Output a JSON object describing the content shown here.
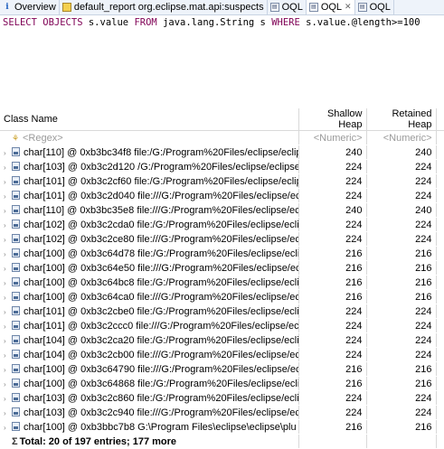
{
  "tabs": [
    {
      "label": "Overview",
      "icon": "info-icon",
      "active": false
    },
    {
      "label": "default_report  org.eclipse.mat.api:suspects",
      "icon": "report-icon",
      "active": false
    },
    {
      "label": "OQL",
      "icon": "oql-icon",
      "active": false
    },
    {
      "label": "OQL",
      "icon": "oql-icon",
      "active": true,
      "close": "✕"
    },
    {
      "label": "OQL",
      "icon": "oql-icon",
      "active": false
    }
  ],
  "query": {
    "kw_select": "SELECT",
    "kw_objects": "OBJECTS",
    "field": "s.value",
    "kw_from": "FROM",
    "klass": "java.lang.String s",
    "kw_where": "WHERE",
    "condition": "s.value.@length>=100"
  },
  "table": {
    "columns": [
      "Class Name",
      "Shallow Heap",
      "Retained Heap"
    ],
    "filter": {
      "regex": "<Regex>",
      "numeric1": "<Numeric>",
      "numeric2": "<Numeric>"
    },
    "rows": [
      {
        "name": "char[110] @ 0xb3bc34f8  file:/G:/Program%20Files/eclipse/eclip",
        "shallow": "240",
        "retained": "240"
      },
      {
        "name": "char[103] @ 0xb3c2d120  /G:/Program%20Files/eclipse/eclipse",
        "shallow": "224",
        "retained": "224"
      },
      {
        "name": "char[101] @ 0xb3c2cf60  file:/G:/Program%20Files/eclipse/eclip",
        "shallow": "224",
        "retained": "224"
      },
      {
        "name": "char[101] @ 0xb3c2d040  file:///G:/Program%20Files/eclipse/ec",
        "shallow": "224",
        "retained": "224"
      },
      {
        "name": "char[110] @ 0xb3bc35e8  file:///G:/Program%20Files/eclipse/ec",
        "shallow": "240",
        "retained": "240"
      },
      {
        "name": "char[102] @ 0xb3c2cda0  file:/G:/Program%20Files/eclipse/ecli",
        "shallow": "224",
        "retained": "224"
      },
      {
        "name": "char[102] @ 0xb3c2ce80  file:///G:/Program%20Files/eclipse/ec",
        "shallow": "224",
        "retained": "224"
      },
      {
        "name": "char[100] @ 0xb3c64d78  file:/G:/Program%20Files/eclipse/ecli",
        "shallow": "216",
        "retained": "216"
      },
      {
        "name": "char[100] @ 0xb3c64e50  file:///G:/Program%20Files/eclipse/ec",
        "shallow": "216",
        "retained": "216"
      },
      {
        "name": "char[100] @ 0xb3c64bc8  file:/G:/Program%20Files/eclipse/ecli",
        "shallow": "216",
        "retained": "216"
      },
      {
        "name": "char[100] @ 0xb3c64ca0  file:///G:/Program%20Files/eclipse/ec",
        "shallow": "216",
        "retained": "216"
      },
      {
        "name": "char[101] @ 0xb3c2cbe0  file:/G:/Program%20Files/eclipse/ecli",
        "shallow": "224",
        "retained": "224"
      },
      {
        "name": "char[101] @ 0xb3c2ccc0  file:///G:/Program%20Files/eclipse/ec",
        "shallow": "224",
        "retained": "224"
      },
      {
        "name": "char[104] @ 0xb3c2ca20  file:/G:/Program%20Files/eclipse/eclip",
        "shallow": "224",
        "retained": "224"
      },
      {
        "name": "char[104] @ 0xb3c2cb00  file:///G:/Program%20Files/eclipse/ec",
        "shallow": "224",
        "retained": "224"
      },
      {
        "name": "char[100] @ 0xb3c64790  file:///G:/Program%20Files/eclipse/ec",
        "shallow": "216",
        "retained": "216"
      },
      {
        "name": "char[100] @ 0xb3c64868  file:/G:/Program%20Files/eclipse/ecli",
        "shallow": "216",
        "retained": "216"
      },
      {
        "name": "char[103] @ 0xb3c2c860  file:/G:/Program%20Files/eclipse/ecli",
        "shallow": "224",
        "retained": "224"
      },
      {
        "name": "char[103] @ 0xb3c2c940  file:///G:/Program%20Files/eclipse/ec",
        "shallow": "224",
        "retained": "224"
      },
      {
        "name": "char[100] @ 0xb3bbc7b8  G:\\Program Files\\eclipse\\eclipse\\plu",
        "shallow": "216",
        "retained": "216"
      }
    ],
    "total": "Total: 20 of 197 entries; 177 more"
  }
}
